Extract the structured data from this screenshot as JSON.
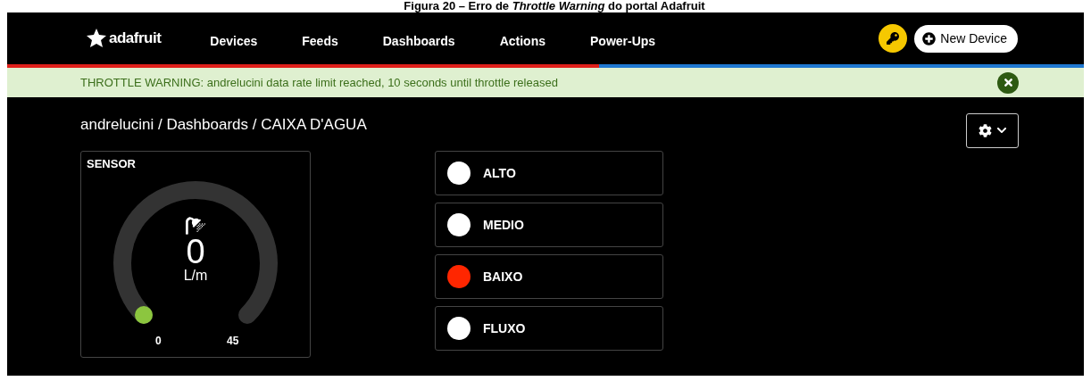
{
  "caption": "Figura 20 – Erro de *Throttle Warning* do portal Adafruit",
  "nav": {
    "logo": "adafruit",
    "items": [
      {
        "label": "Devices"
      },
      {
        "label": "Feeds"
      },
      {
        "label": "Dashboards"
      },
      {
        "label": "Actions"
      },
      {
        "label": "Power-Ups"
      }
    ],
    "new_device": "New Device"
  },
  "throttle_bar": {
    "level": 0.55
  },
  "banner": {
    "text": "THROTTLE WARNING: andrelucini data rate limit reached, 10 seconds until throttle released"
  },
  "breadcrumb": "andrelucini / Dashboards / CAIXA D'AGUA",
  "gauge": {
    "title": "SENSOR",
    "value": "0",
    "unit": "L/m",
    "min": "0",
    "max": "45"
  },
  "indicators": [
    {
      "label": "ALTO",
      "color": "#ffffff"
    },
    {
      "label": "MEDIO",
      "color": "#ffffff"
    },
    {
      "label": "BAIXO",
      "color": "#ff2600"
    },
    {
      "label": "FLUXO",
      "color": "#ffffff"
    }
  ]
}
